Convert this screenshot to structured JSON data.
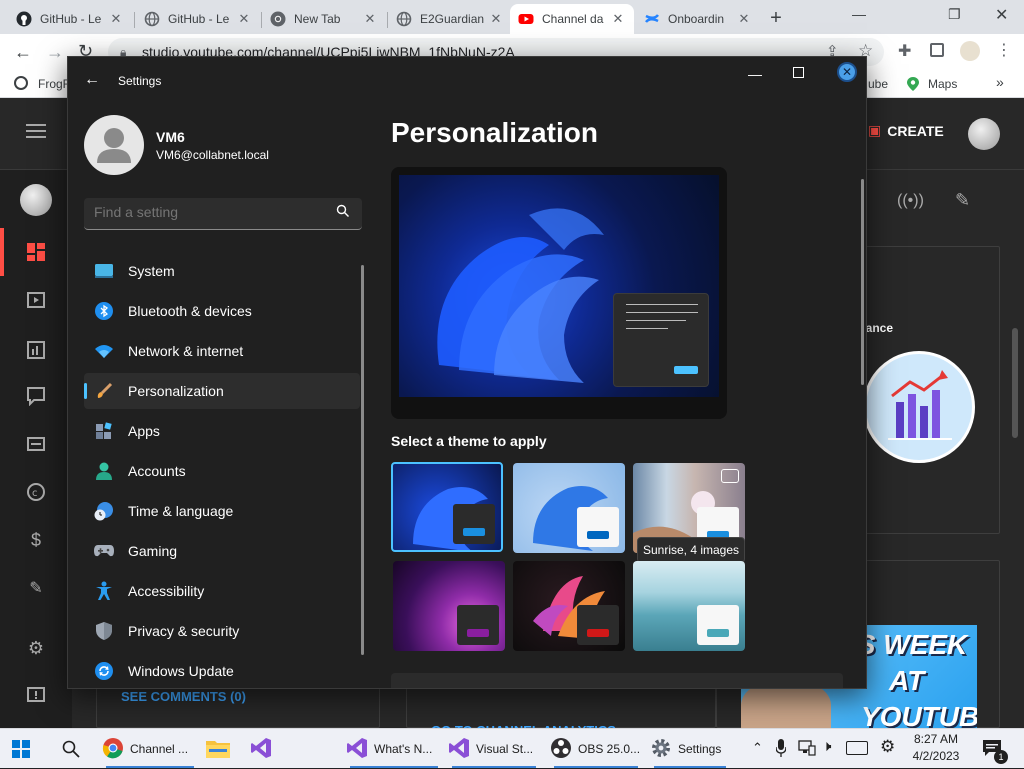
{
  "browser": {
    "tabs": [
      {
        "title": "GitHub - Le",
        "icon": "github-icon"
      },
      {
        "title": "GitHub - Le",
        "icon": "globe-icon"
      },
      {
        "title": "New Tab",
        "icon": "chrome-icon"
      },
      {
        "title": "E2Guardian",
        "icon": "globe-icon"
      },
      {
        "title": "Channel da",
        "icon": "youtube-icon"
      },
      {
        "title": "Onboardin",
        "icon": "confluence-icon"
      }
    ],
    "url": "studio.youtube.com/channel/UCPpi5LiwNBM_1fNbNuN-z2A",
    "bookmarks": [
      {
        "label": "FrogF"
      },
      {
        "label": "ube"
      },
      {
        "label": "Maps"
      }
    ]
  },
  "youtube": {
    "create_label": "CREATE",
    "performance_label": "mance",
    "see_comments": "SEE COMMENTS (0)",
    "go_to_analytics": "GO TO CHANNEL ANALYTICS",
    "thumbnail_text": [
      "IS WEEK",
      "AT",
      "YOUTUBE"
    ]
  },
  "settings": {
    "window_title": "Settings",
    "user": {
      "name": "VM6",
      "email": "VM6@collabnet.local"
    },
    "search": {
      "placeholder": "Find a setting"
    },
    "nav": [
      {
        "label": "System",
        "icon": "system-icon"
      },
      {
        "label": "Bluetooth & devices",
        "icon": "bluetooth-icon"
      },
      {
        "label": "Network & internet",
        "icon": "wifi-icon"
      },
      {
        "label": "Personalization",
        "icon": "brush-icon",
        "selected": true
      },
      {
        "label": "Apps",
        "icon": "apps-icon"
      },
      {
        "label": "Accounts",
        "icon": "accounts-icon"
      },
      {
        "label": "Time & language",
        "icon": "clock-globe-icon"
      },
      {
        "label": "Gaming",
        "icon": "gamepad-icon"
      },
      {
        "label": "Accessibility",
        "icon": "accessibility-icon"
      },
      {
        "label": "Privacy & security",
        "icon": "shield-icon"
      },
      {
        "label": "Windows Update",
        "icon": "update-icon"
      }
    ],
    "page_title": "Personalization",
    "theme_heading": "Select a theme to apply",
    "tooltip": "Sunrise, 4 images",
    "themes": [
      {
        "name": "windows-dark",
        "accent": "#1a8fe0",
        "selected": true
      },
      {
        "name": "windows-light",
        "accent": "#0067c0"
      },
      {
        "name": "sunrise",
        "accent": "#1a8fe0"
      },
      {
        "name": "glow",
        "accent": "#8a1ea0"
      },
      {
        "name": "captured-motion",
        "accent": "#d01818"
      },
      {
        "name": "flow",
        "accent": "#4aa8b8"
      }
    ]
  },
  "taskbar": {
    "items": [
      {
        "label": "Channel ...",
        "icon": "chrome-icon"
      },
      {
        "label": "",
        "icon": "file-explorer-icon"
      },
      {
        "label": "",
        "icon": "visual-studio-icon"
      },
      {
        "label": "What's N...",
        "icon": "visual-studio-icon"
      },
      {
        "label": "Visual St...",
        "icon": "visual-studio-icon"
      },
      {
        "label": "OBS 25.0...",
        "icon": "obs-icon"
      },
      {
        "label": "Settings",
        "icon": "settings-gear-icon"
      }
    ],
    "time": "8:27 AM",
    "date": "4/2/2023",
    "notification_count": "1"
  },
  "colors": {
    "accent": "#4cc2ff",
    "settings_bg": "#202020",
    "youtube_bg": "#282828",
    "taskbar_bg": "#eef0f6"
  }
}
